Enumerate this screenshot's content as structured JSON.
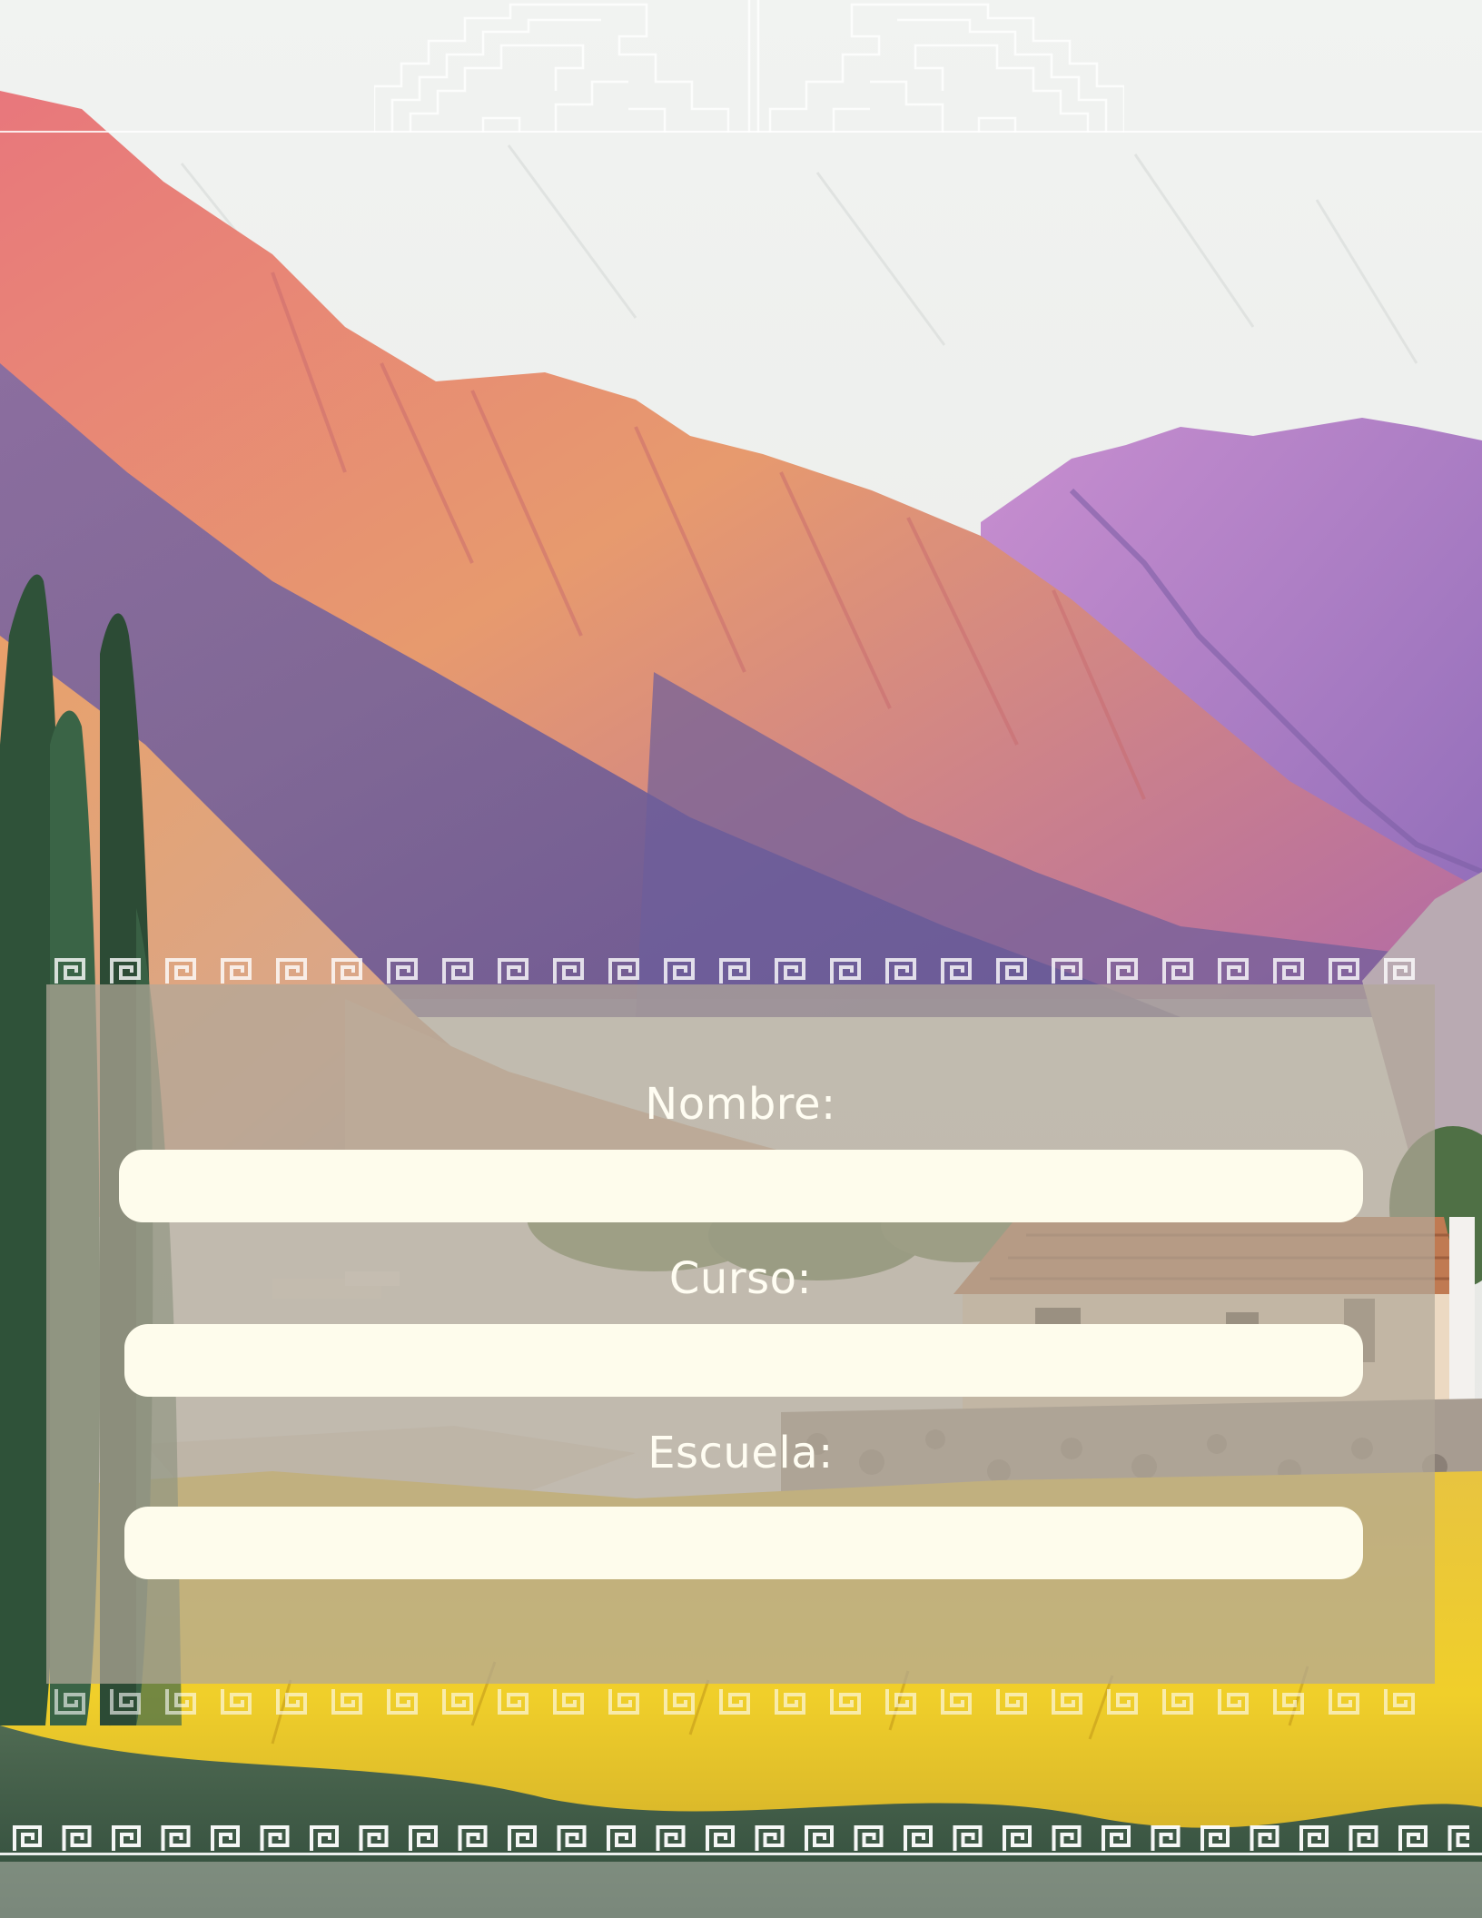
{
  "form": {
    "name_label": "Nombre:",
    "name_value": "",
    "course_label": "Curso:",
    "course_value": "",
    "school_label": "Escuela:",
    "school_value": ""
  },
  "decorations": {
    "border_pattern": "greek-key-icon",
    "header_ornament": "andean-stepped-motif-icon"
  },
  "colors": {
    "sky": "#ecedea",
    "mountain_pink": "#e07d86",
    "mountain_violet": "#8a7bb8",
    "field_gold": "#e8c43a",
    "panel": "#b2a898",
    "input_fill": "#fefcec",
    "label_text": "#fffdf2"
  }
}
